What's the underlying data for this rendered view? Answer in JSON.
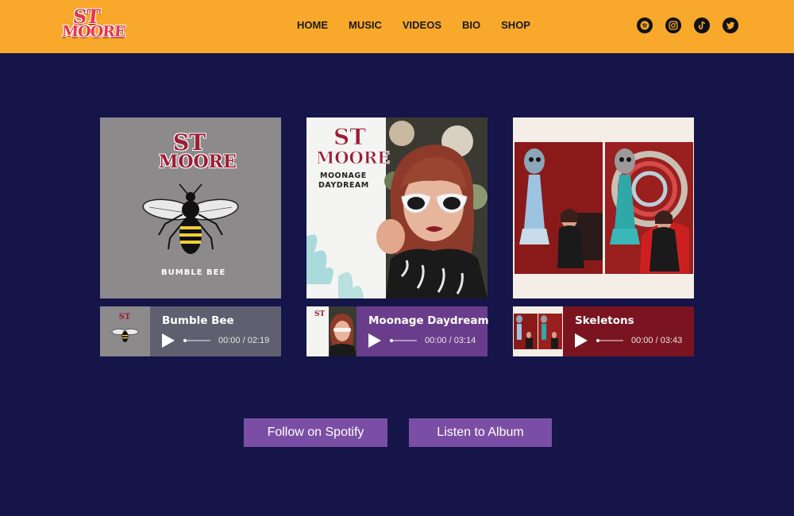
{
  "brand": {
    "logo_line1": "ST",
    "logo_line2": "MOORE"
  },
  "nav": {
    "items": [
      "HOME",
      "MUSIC",
      "VIDEOS",
      "BIO",
      "SHOP"
    ]
  },
  "socials": [
    "spotify-icon",
    "instagram-icon",
    "tiktok-icon",
    "twitter-icon"
  ],
  "tracks": [
    {
      "title": "Bumble Bee",
      "time": "00:00 / 02:19",
      "cover_caption": "BUMBLE BEE",
      "player_color": "#5f5f6f"
    },
    {
      "title": "Moonage Daydream",
      "time": "00:00 / 03:14",
      "cover_caption_1": "MOONAGE",
      "cover_caption_2": "DAYDREAM",
      "player_color": "#6a3d8c"
    },
    {
      "title": "Skeletons",
      "time": "00:00 / 03:43",
      "player_color": "#7a1420"
    }
  ],
  "buttons": {
    "follow": "Follow on Spotify",
    "listen": "Listen to Album"
  },
  "colors": {
    "header": "#f8a82a",
    "background": "#15154a",
    "button": "#7b4ea6"
  }
}
